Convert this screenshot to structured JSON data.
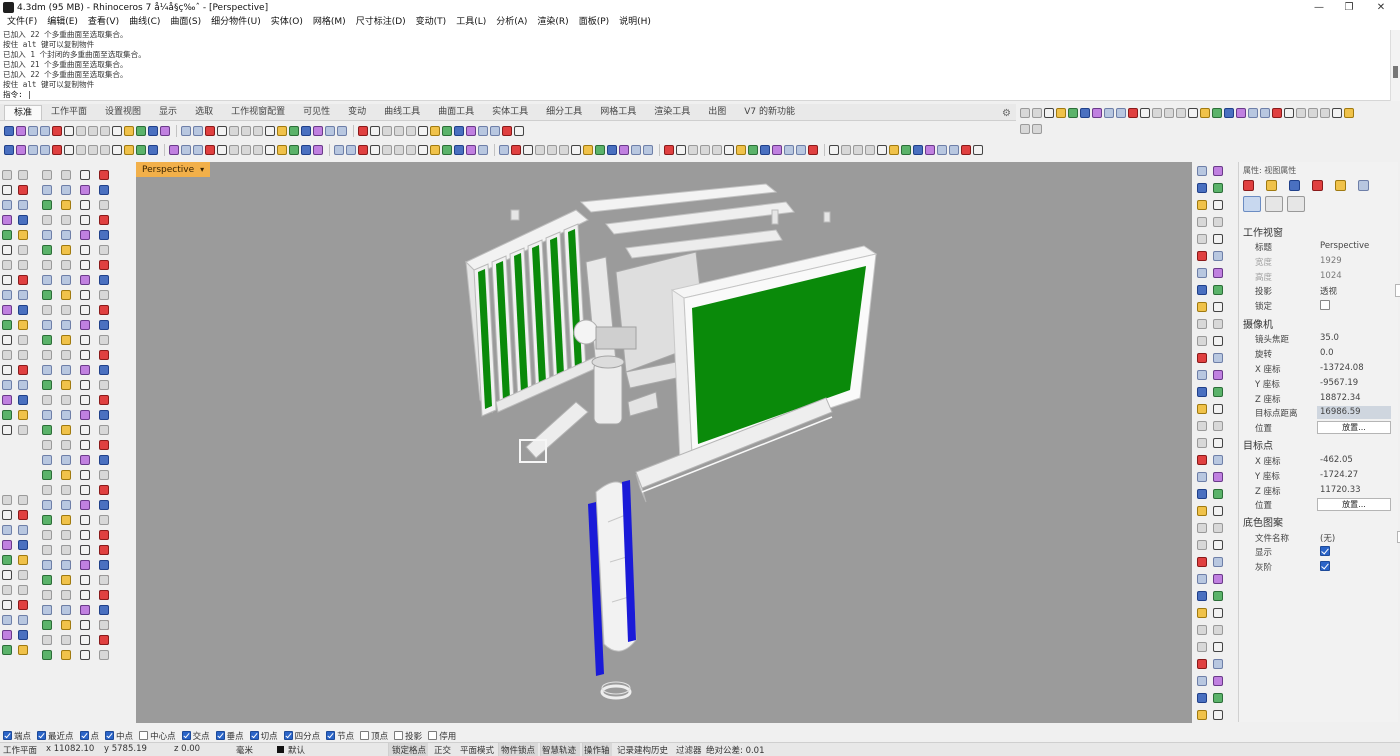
{
  "window": {
    "title": "4.3dm (95 MB) - Rhinoceros 7 å¼å§ç‰ˆ - [Perspective]",
    "minimize": "—",
    "maximize": "❐",
    "close": "✕"
  },
  "menu": [
    "文件(F)",
    "编辑(E)",
    "查看(V)",
    "曲线(C)",
    "曲面(S)",
    "细分物件(U)",
    "实体(O)",
    "网格(M)",
    "尺寸标注(D)",
    "变动(T)",
    "工具(L)",
    "分析(A)",
    "渲染(R)",
    "面板(P)",
    "说明(H)"
  ],
  "command_history": [
    "已加入 22 个多重曲面至选取集合。",
    "按住 alt 键可以复制物件",
    "已加入 1 个封闭的多重曲面至选取集合。",
    "已加入 21 个多重曲面至选取集合。",
    "已加入 22 个多重曲面至选取集合。",
    "按住 alt 键可以复制物件"
  ],
  "command_prompt": "指令: |",
  "tabs": [
    "标准",
    "工作平面",
    "设置视图",
    "显示",
    "选取",
    "工作视窗配置",
    "可见性",
    "变动",
    "曲线工具",
    "曲面工具",
    "实体工具",
    "细分工具",
    "网格工具",
    "渲染工具",
    "出图",
    "V7 的新功能"
  ],
  "active_tab": "标准",
  "viewport": {
    "label": "Perspective",
    "background": "#9b9b9b",
    "screen_color": "#0a8a0a",
    "accent_color": "#1a1ad8"
  },
  "properties": {
    "header": "属性: 视图属性",
    "section_viewport": "工作视窗",
    "rows_viewport": [
      {
        "k": "标题",
        "v": "Perspective"
      },
      {
        "k": "宽度",
        "v": "1929"
      },
      {
        "k": "高度",
        "v": "1024"
      },
      {
        "k": "投影",
        "v": "透视"
      },
      {
        "k": "锁定",
        "v": ""
      }
    ],
    "section_camera": "摄像机",
    "rows_camera": [
      {
        "k": "镜头焦距",
        "v": "35.0"
      },
      {
        "k": "旋转",
        "v": "0.0"
      },
      {
        "k": "X 座标",
        "v": "-13724.08"
      },
      {
        "k": "Y 座标",
        "v": "-9567.19"
      },
      {
        "k": "Z 座标",
        "v": "18872.34"
      },
      {
        "k": "目标点距离",
        "v": "16986.59"
      },
      {
        "k": "位置",
        "v": "放置..."
      }
    ],
    "section_target": "目标点",
    "rows_target": [
      {
        "k": "X 座标",
        "v": "-462.05"
      },
      {
        "k": "Y 座标",
        "v": "-1724.27"
      },
      {
        "k": "Z 座标",
        "v": "11720.33"
      },
      {
        "k": "位置",
        "v": "放置..."
      }
    ],
    "section_wallpaper": "底色图案",
    "rows_wallpaper": [
      {
        "k": "文件名称",
        "v": "(无)"
      },
      {
        "k": "显示",
        "v": ""
      },
      {
        "k": "灰阶",
        "v": ""
      }
    ],
    "dots": "...",
    "dropdown": "⌄"
  },
  "osnaps": [
    {
      "label": "端点",
      "on": true
    },
    {
      "label": "最近点",
      "on": true
    },
    {
      "label": "点",
      "on": true
    },
    {
      "label": "中点",
      "on": true
    },
    {
      "label": "中心点",
      "on": false
    },
    {
      "label": "交点",
      "on": true
    },
    {
      "label": "垂点",
      "on": true
    },
    {
      "label": "切点",
      "on": true
    },
    {
      "label": "四分点",
      "on": true
    },
    {
      "label": "节点",
      "on": true
    },
    {
      "label": "顶点",
      "on": false
    },
    {
      "label": "投影",
      "on": false
    },
    {
      "label": "停用",
      "on": false
    }
  ],
  "status": {
    "cplane": "工作平面",
    "x": "x 11082.10",
    "y": "y 5785.19",
    "z": "z 0.00",
    "units": "毫米",
    "layer": "默认",
    "grid_snap": "锁定格点",
    "ortho": "正交",
    "planar": "平面模式",
    "osnap": "物件锁点",
    "smarttrack": "智慧轨迹",
    "gumball": "操作轴",
    "history": "记录建构历史",
    "filter": "过滤器",
    "tolerance": "绝对公差: 0.01"
  }
}
